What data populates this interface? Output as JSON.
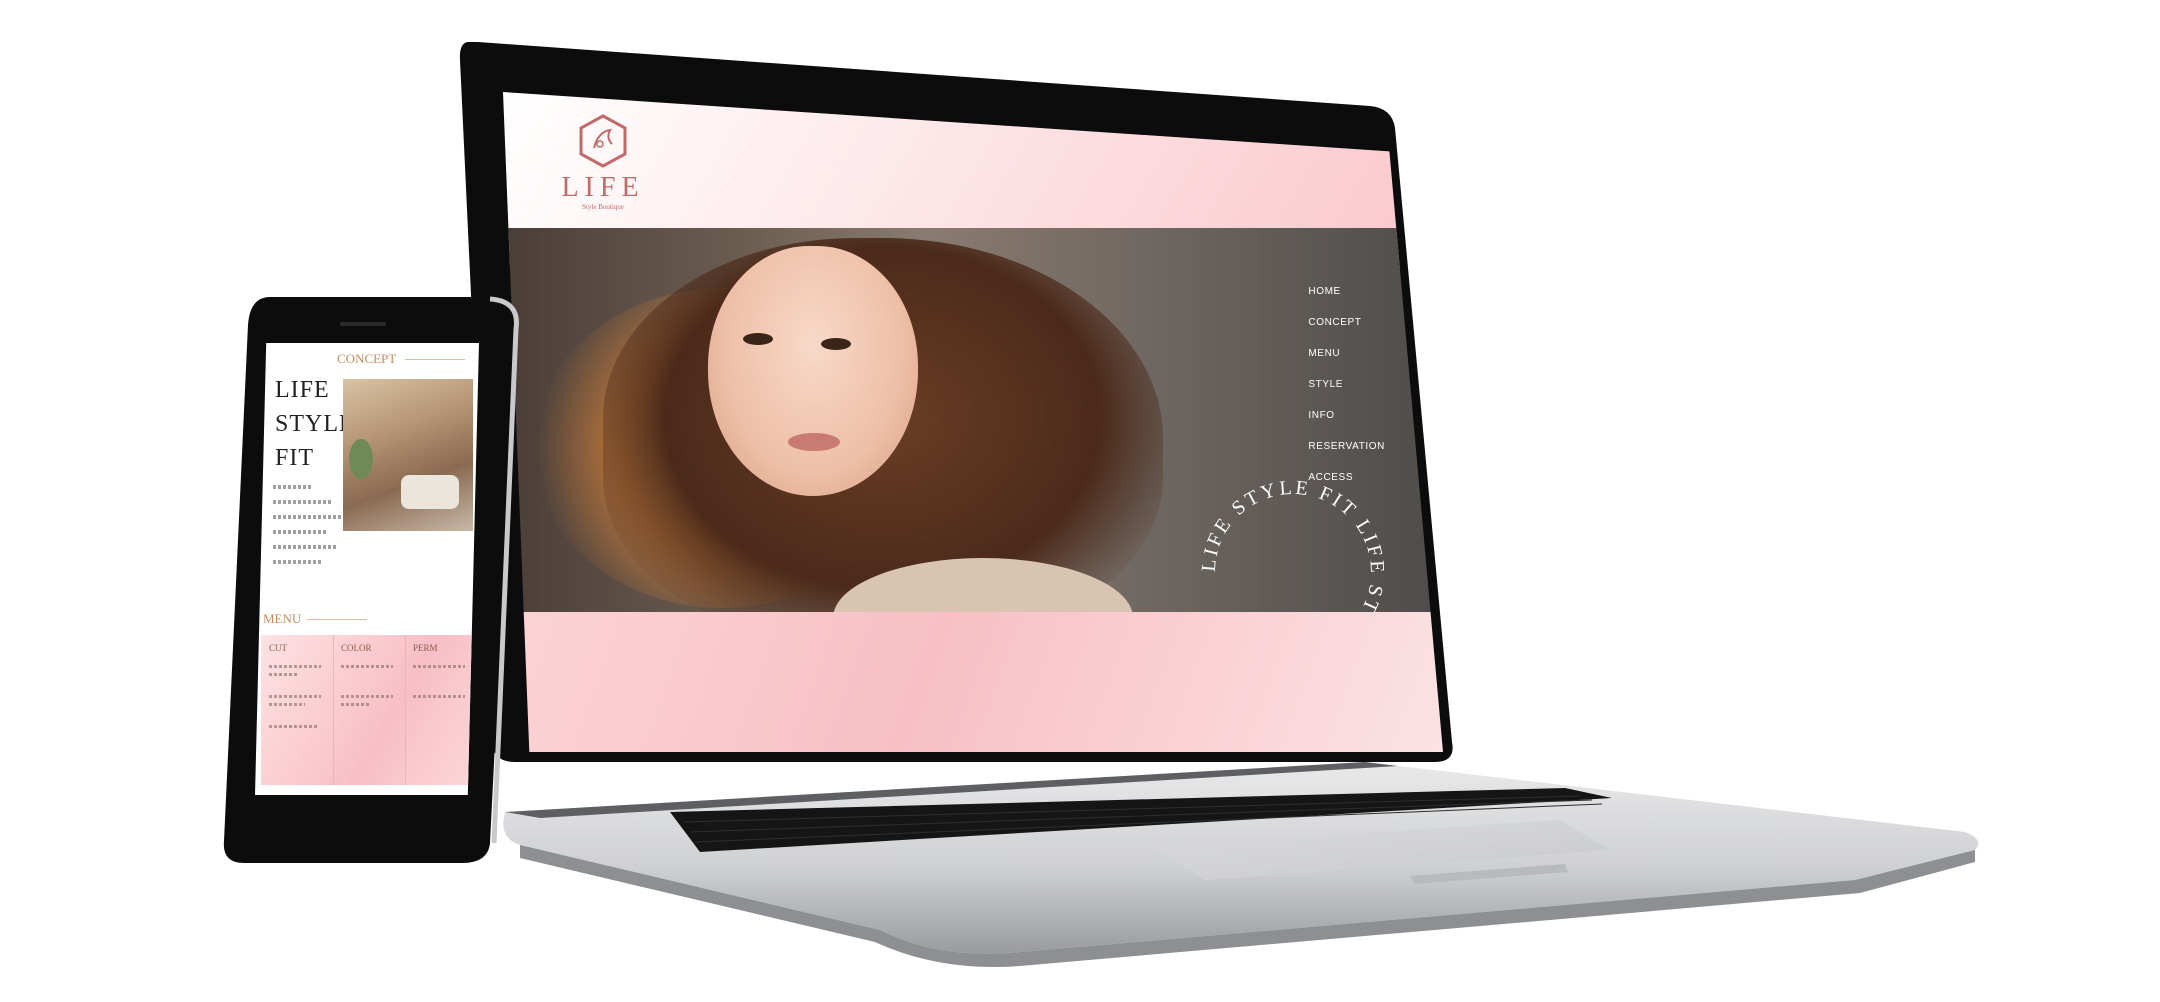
{
  "site": {
    "logo_word": "LIFE",
    "logo_tagline": "Style Boutique",
    "nav_items": [
      "HOME",
      "CONCEPT",
      "MENU",
      "STYLE",
      "INFO",
      "RESERVATION",
      "ACCESS"
    ],
    "hero_ring_text": "LIFE STYLE FIT  LIFE STYLE FIT  "
  },
  "phone": {
    "concept_heading": "CONCEPT",
    "title_lines": [
      "LIFE",
      "STYLE",
      "FIT"
    ],
    "menu_heading": "MENU",
    "menu_columns": [
      "CUT",
      "COLOR",
      "PERM"
    ]
  },
  "colors": {
    "accent_pink": "#f8c0c5",
    "brand_rose": "#c26a6a",
    "heading_copper": "#c98a62"
  }
}
